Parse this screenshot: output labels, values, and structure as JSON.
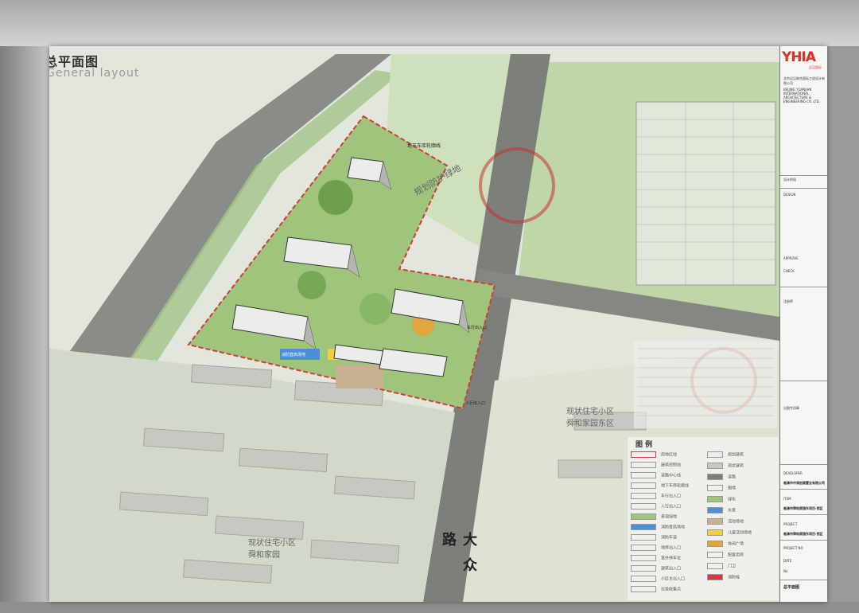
{
  "drawing": {
    "title_cn": "总平面图",
    "title_en": "General layout"
  },
  "map": {
    "road_name": "大众路",
    "green_belt_label": "规划防护绿地",
    "underground_garage_label": "地下车库轮廓线",
    "residential_east_label": "现状住宅小区\n舜和家园东区",
    "residential_south_label": "现状住宅小区\n舜和家园",
    "fire_path_label": "消防登高场地",
    "entrance_labels": [
      "人行出入口",
      "车行出入口"
    ],
    "legend_title": "图 例",
    "legend_items_left": [
      "用地红线",
      "建筑控制线",
      "道路中心线",
      "地下车库轮廓线",
      "车行出入口",
      "人行出入口",
      "景观绿地",
      "消防登高场地",
      "消防车道",
      "地库出入口",
      "室外停车位",
      "建筑出入口",
      "小区主出入口",
      "垃圾收集点"
    ],
    "legend_items_right": [
      "规划建筑",
      "现状建筑",
      "道路",
      "围墙",
      "绿化",
      "水景",
      "活动场地",
      "儿童活动场地",
      "休闲广场",
      "配套用房",
      "门卫",
      "消防栓"
    ]
  },
  "title_block": {
    "logo": "YHIA",
    "logo_sub": "远见国际",
    "company_cn": "北京远见联合国际工程设计有限公司",
    "company_en": "BEIJING YUANJIAN INTERNATIONAL ARCHITECTURE & ENGINEERING CO. LTD.",
    "design_stage_label": "设计阶段",
    "approve_label": "APPROVE",
    "check_label": "CHECK",
    "design_label": "DESIGN",
    "developer_label": "DEVELOPER",
    "developer_value": "临清市中润创展置业有限公司",
    "item_label": "ITEM",
    "item_value": "临清市舜和家园东项目-西区",
    "project_label": "PROJECT",
    "project_value": "临清市舜和家园东项目-西区",
    "project_no_label": "PROJECT NO",
    "date_label": "DATE",
    "no_label": "No",
    "drawing_name_label": "总平面图",
    "remarks_label": "注册师",
    "seal_label": "出图专用章"
  },
  "colors": {
    "site_red": "#d23b3b",
    "green": "#7fb25a",
    "road": "#7c7f7a",
    "building": "#e4e4e4",
    "logo_red": "#d6322c"
  }
}
